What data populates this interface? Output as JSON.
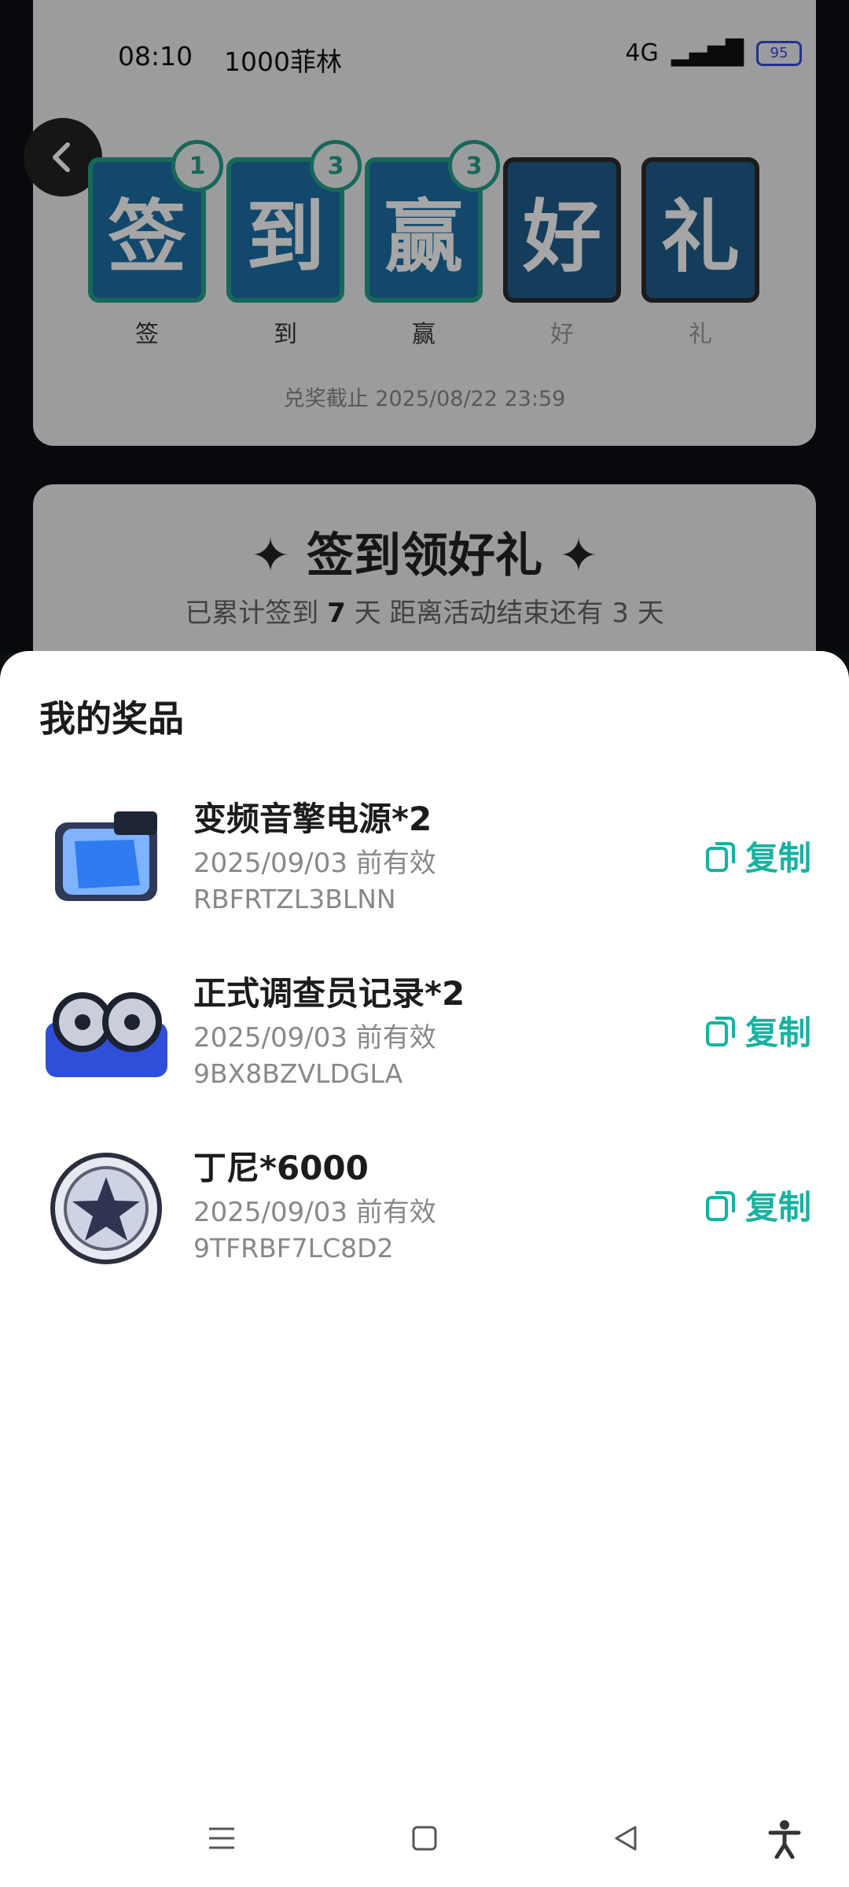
{
  "status_bar": {
    "time": "08:10",
    "carrier": "1000菲林",
    "battery": "95",
    "network": "4G"
  },
  "event": {
    "tiles": [
      {
        "char": "签",
        "label": "签",
        "badge": "1"
      },
      {
        "char": "到",
        "label": "到",
        "badge": "3"
      },
      {
        "char": "赢",
        "label": "赢",
        "badge": "3"
      },
      {
        "char": "好",
        "label": "好",
        "badge": ""
      },
      {
        "char": "礼",
        "label": "礼",
        "badge": ""
      }
    ],
    "deadline": "兑奖截止 2025/08/22 23:59",
    "section_title": "签到领好礼",
    "subtitle_prefix": "已累计签到",
    "signed_days": "7",
    "subtitle_mid": "天  距离活动结束还有",
    "days_left": "3",
    "subtitle_suffix": "天"
  },
  "sheet": {
    "title": "我的奖品",
    "prizes": [
      {
        "name": "变频音擎电源*2",
        "valid": "2025/09/03 前有效",
        "code": "RBFRTZL3BLNN",
        "copy": "复制",
        "icon": "power-module-icon"
      },
      {
        "name": "正式调查员记录*2",
        "valid": "2025/09/03 前有效",
        "code": "9BX8BZVLDGLA",
        "copy": "复制",
        "icon": "tape-record-icon"
      },
      {
        "name": "丁尼*6000",
        "valid": "2025/09/03 前有效",
        "code": "9TFRBF7LC8D2",
        "copy": "复制",
        "icon": "coin-icon"
      }
    ]
  },
  "colors": {
    "accent": "#17b2a1",
    "tile_blue": "#1c6fa6",
    "tile_border": "#25a089"
  }
}
